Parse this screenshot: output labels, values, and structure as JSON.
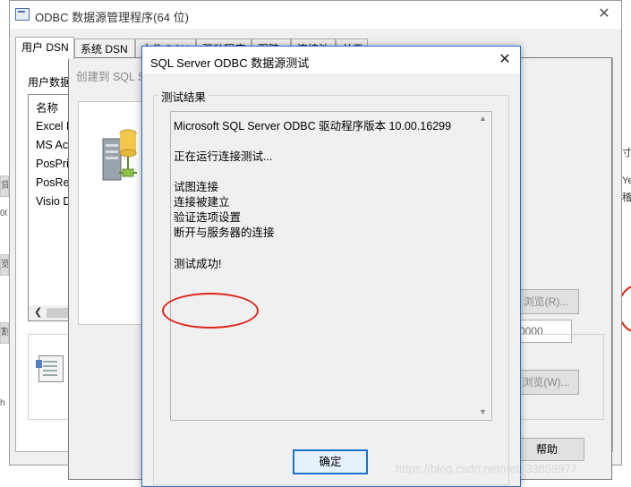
{
  "background": {
    "left_fragments": [
      "贷",
      "00",
      "览",
      "割",
      "h"
    ],
    "right_fragments": [
      "寸",
      "Ye",
      "稽"
    ]
  },
  "odbc_window": {
    "title": "ODBC 数据源管理程序(64 位)",
    "close_glyph": "✕",
    "tabs": [
      "用户 DSN",
      "系统 DSN",
      "文件 DSN",
      "驱动程序",
      "跟踪",
      "连接池",
      "关于"
    ],
    "user_ds_label": "用户数据源",
    "data_sources": [
      "名称",
      "Excel F",
      "MS Ac",
      "PosPri",
      "PosRe",
      "Visio D"
    ]
  },
  "wizard": {
    "title": "创建到 SQL Server 的新数据源",
    "browse_r": "浏览(R)...",
    "port_value": "0000",
    "browse_w": "浏览(W)...",
    "help": "帮助"
  },
  "dialog": {
    "title": "SQL Server ODBC 数据源测试",
    "close_glyph": "✕",
    "group_label": "测试结果",
    "lines": [
      "Microsoft SQL Server ODBC 驱动程序版本 10.00.16299",
      "正在运行连接测试...",
      "试图连接",
      "连接被建立",
      "验证选项设置",
      "断开与服务器的连接",
      "测试成功!"
    ],
    "ok_label": "确定"
  },
  "watermark": "https://blog.csdn.net/net_33859977",
  "colors": {
    "accent_border": "#1c72c7",
    "annotation_red": "#e0231b",
    "window_bg": "#f0f0f0"
  }
}
